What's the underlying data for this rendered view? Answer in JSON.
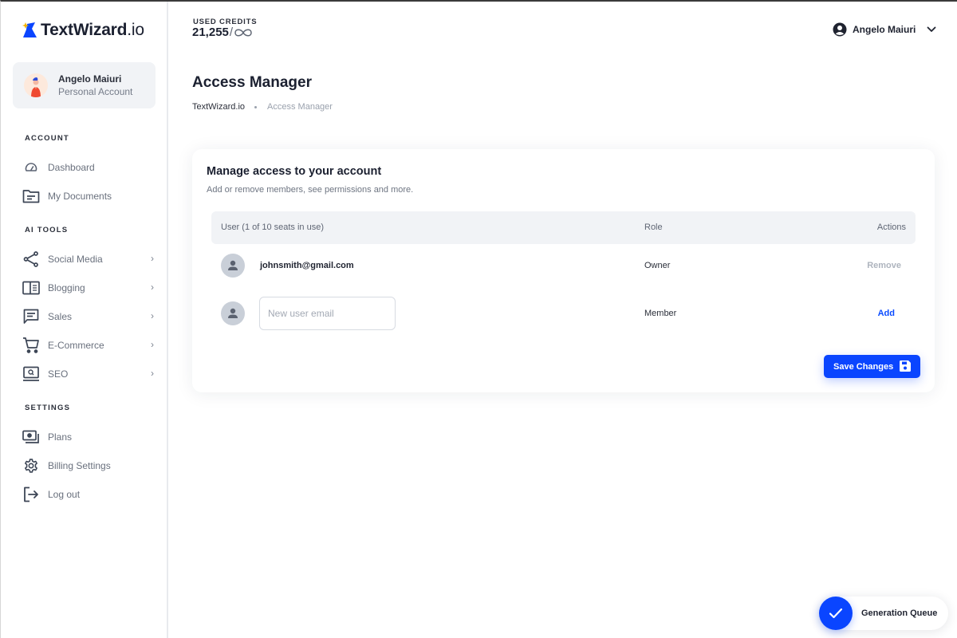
{
  "app": {
    "logo_name": "TextWizard",
    "logo_suffix": ".io"
  },
  "account_card": {
    "name": "Angelo Maiuri",
    "type": "Personal Account"
  },
  "sidebar": {
    "sections": [
      {
        "title": "ACCOUNT"
      },
      {
        "title": "AI TOOLS"
      },
      {
        "title": "SETTINGS"
      }
    ],
    "items": [
      {
        "label": "Dashboard",
        "icon": "dashboard-icon",
        "has_submenu": false
      },
      {
        "label": "My Documents",
        "icon": "folder-icon",
        "has_submenu": false
      },
      {
        "label": "Social Media",
        "icon": "share-icon",
        "has_submenu": true
      },
      {
        "label": "Blogging",
        "icon": "article-icon",
        "has_submenu": true
      },
      {
        "label": "Sales",
        "icon": "message-icon",
        "has_submenu": true
      },
      {
        "label": "E-Commerce",
        "icon": "cart-icon",
        "has_submenu": true
      },
      {
        "label": "SEO",
        "icon": "laptop-search-icon",
        "has_submenu": true
      },
      {
        "label": "Plans",
        "icon": "money-icon",
        "has_submenu": false
      },
      {
        "label": "Billing Settings",
        "icon": "gear-icon",
        "has_submenu": false
      },
      {
        "label": "Log out",
        "icon": "logout-icon",
        "has_submenu": false
      }
    ],
    "chevron": "›"
  },
  "topbar": {
    "credits_label": "USED CREDITS",
    "credits_used": "21,255",
    "credits_separator": "/",
    "credits_limit": "∞",
    "user_name": "Angelo Maiuri"
  },
  "page": {
    "title": "Access Manager",
    "breadcrumb": [
      "TextWizard.io",
      "Access Manager"
    ]
  },
  "card": {
    "title": "Manage access to your account",
    "subtitle": "Add or remove members, see permissions and more.",
    "columns": {
      "user": "User (1 of 10 seats in use)",
      "role": "Role",
      "actions": "Actions"
    },
    "rows": [
      {
        "email": "johnsmith@gmail.com",
        "role": "Owner",
        "action": "Remove"
      }
    ],
    "new_row": {
      "placeholder": "New user email",
      "value": "",
      "role": "Member",
      "action": "Add"
    },
    "save_label": "Save Changes"
  },
  "generation_queue": {
    "label": "Generation Queue"
  },
  "colors": {
    "accent": "#0a45ff",
    "text_dark": "#1b2030",
    "muted": "#69707d"
  }
}
